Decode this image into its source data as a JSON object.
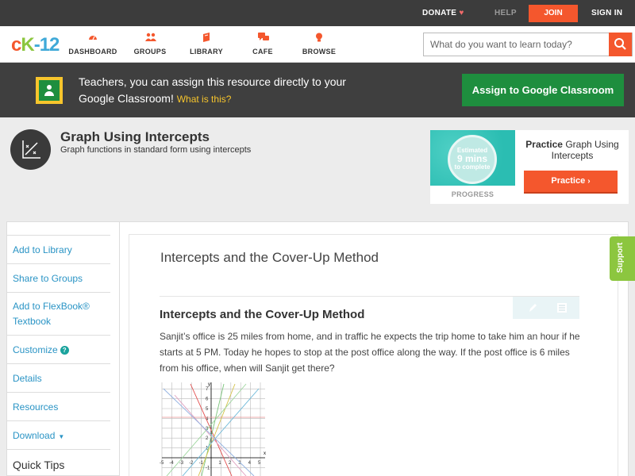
{
  "topbar": {
    "donate": "DONATE",
    "help": "HELP",
    "join": "JOIN",
    "signin": "SIGN IN"
  },
  "header": {
    "logo": {
      "c": "c",
      "k": "K",
      "n": "-12"
    },
    "nav": [
      {
        "label": "DASHBOARD",
        "icon": "dashboard-icon"
      },
      {
        "label": "GROUPS",
        "icon": "groups-icon"
      },
      {
        "label": "LIBRARY",
        "icon": "library-icon"
      },
      {
        "label": "CAFE",
        "icon": "cafe-icon"
      },
      {
        "label": "BROWSE",
        "icon": "browse-icon"
      }
    ],
    "search_placeholder": "What do you want to learn today?"
  },
  "classroom_banner": {
    "text": "Teachers, you can assign this resource directly to your Google Classroom!",
    "what_link": "What is this?",
    "assign_button": "Assign to Google Classroom"
  },
  "concept": {
    "title": "Graph Using Intercepts",
    "subtitle": "Graph functions in standard form using intercepts"
  },
  "practice_card": {
    "estimated": "Estimated",
    "mins": "9 mins",
    "to_complete": "to complete",
    "progress_label": "PROGRESS",
    "title_bold": "Practice",
    "title_rest": "Graph Using Intercepts",
    "button": "Practice"
  },
  "sidebar": {
    "add_library": "Add to Library",
    "share_groups": "Share to Groups",
    "add_flexbook": "Add to FlexBook®",
    "add_flexbook_2": "Textbook",
    "customize": "Customize",
    "details": "Details",
    "resources": "Resources",
    "download": "Download",
    "quick_tips": "Quick Tips"
  },
  "content": {
    "title": "Intercepts and the Cover-Up Method",
    "heading": "Intercepts and the Cover-Up Method",
    "paragraph": "Sanjit’s office is 25 miles from home, and in traffic he expects the trip home to take him an hour if he starts at 5 PM. Today he hopes to stop at the post office along the way. If the post office is 6 miles from his office, when will Sanjit get there?"
  },
  "graph": {
    "x_ticks": [
      "-5",
      "-4",
      "-3",
      "-2",
      "-1",
      "1",
      "2",
      "3",
      "4",
      "5"
    ],
    "y_ticks": [
      "7",
      "6",
      "5",
      "4",
      "3",
      "2",
      "1",
      "-1"
    ],
    "x_label": "x",
    "y_label": "y"
  },
  "support_tab": "Support",
  "colors": {
    "accent": "#f4572d",
    "green": "#1e8e3e",
    "link": "#2a94c5",
    "brand_green": "#8cc63f"
  }
}
